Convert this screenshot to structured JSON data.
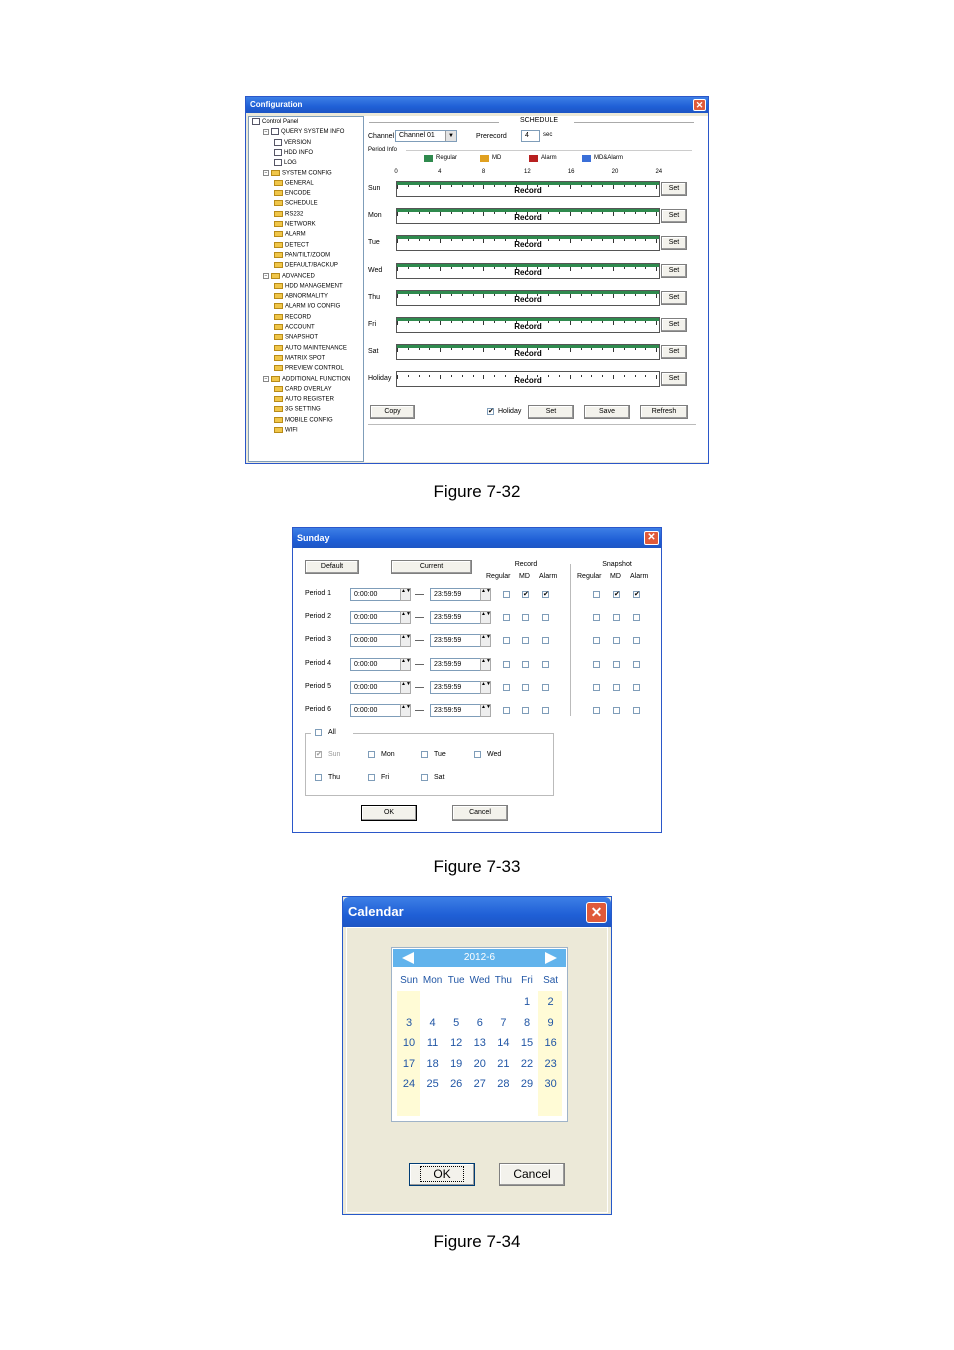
{
  "fig1": {
    "title": "Configuration",
    "tree": [
      {
        "label": "Control Panel",
        "icon": "computer-icon",
        "level": 0
      },
      {
        "label": "QUERY SYSTEM INFO",
        "icon": "doc-icon",
        "level": 1
      },
      {
        "label": "VERSION",
        "icon": "doc-icon",
        "level": 2
      },
      {
        "label": "HDD INFO",
        "icon": "doc-icon",
        "level": 2
      },
      {
        "label": "LOG",
        "icon": "doc-icon",
        "level": 2
      },
      {
        "label": "SYSTEM CONFIG",
        "icon": "folder-icon",
        "level": 1
      },
      {
        "label": "GENERAL",
        "icon": "folder-icon",
        "level": 2
      },
      {
        "label": "ENCODE",
        "icon": "folder-icon",
        "level": 2
      },
      {
        "label": "SCHEDULE",
        "icon": "folder-icon",
        "level": 2
      },
      {
        "label": "RS232",
        "icon": "folder-icon",
        "level": 2
      },
      {
        "label": "NETWORK",
        "icon": "folder-icon",
        "level": 2
      },
      {
        "label": "ALARM",
        "icon": "folder-icon",
        "level": 2
      },
      {
        "label": "DETECT",
        "icon": "folder-icon",
        "level": 2
      },
      {
        "label": "PAN/TILT/ZOOM",
        "icon": "folder-icon",
        "level": 2
      },
      {
        "label": "DEFAULT/BACKUP",
        "icon": "folder-icon",
        "level": 2
      },
      {
        "label": "ADVANCED",
        "icon": "folder-icon",
        "level": 1
      },
      {
        "label": "HDD MANAGEMENT",
        "icon": "folder-icon",
        "level": 2
      },
      {
        "label": "ABNORMALITY",
        "icon": "folder-icon",
        "level": 2
      },
      {
        "label": "ALARM I/O CONFIG",
        "icon": "folder-icon",
        "level": 2
      },
      {
        "label": "RECORD",
        "icon": "folder-icon",
        "level": 2
      },
      {
        "label": "ACCOUNT",
        "icon": "folder-icon",
        "level": 2
      },
      {
        "label": "SNAPSHOT",
        "icon": "folder-icon",
        "level": 2
      },
      {
        "label": "AUTO MAINTENANCE",
        "icon": "folder-icon",
        "level": 2
      },
      {
        "label": "MATRIX SPOT",
        "icon": "folder-icon",
        "level": 2
      },
      {
        "label": "PREVIEW CONTROL",
        "icon": "folder-icon",
        "level": 2
      },
      {
        "label": "ADDITIONAL FUNCTION",
        "icon": "folder-icon",
        "level": 1
      },
      {
        "label": "CARD OVERLAY",
        "icon": "folder-icon",
        "level": 2
      },
      {
        "label": "AUTO REGISTER",
        "icon": "folder-icon",
        "level": 2
      },
      {
        "label": "3G SETTING",
        "icon": "folder-icon",
        "level": 2
      },
      {
        "label": "MOBILE CONFIG",
        "icon": "folder-icon",
        "level": 2
      },
      {
        "label": "WIFI",
        "icon": "folder-icon",
        "level": 2
      }
    ],
    "section_title": "SCHEDULE",
    "channel_label": "Channel",
    "channel_value": "Channel 01",
    "prerecord_label": "Prerecord",
    "prerecord_value": "4",
    "sec_label": "sec",
    "period_info_label": "Period Info",
    "legend": [
      {
        "label": "Regular",
        "color": "#2f8a4e"
      },
      {
        "label": "MD",
        "color": "#e0a020"
      },
      {
        "label": "Alarm",
        "color": "#b82020"
      },
      {
        "label": "MD&Alarm",
        "color": "#3a6fd8"
      }
    ],
    "hours": [
      "0",
      "4",
      "8",
      "12",
      "16",
      "20",
      "24"
    ],
    "days": [
      {
        "name": "Sun",
        "bar": "Record",
        "set": "Set",
        "regular": true
      },
      {
        "name": "Mon",
        "bar": "Record",
        "set": "Set",
        "regular": true
      },
      {
        "name": "Tue",
        "bar": "Record",
        "set": "Set",
        "regular": true
      },
      {
        "name": "Wed",
        "bar": "Record",
        "set": "Set",
        "regular": true
      },
      {
        "name": "Thu",
        "bar": "Record",
        "set": "Set",
        "regular": true
      },
      {
        "name": "Fri",
        "bar": "Record",
        "set": "Set",
        "regular": true
      },
      {
        "name": "Sat",
        "bar": "Record",
        "set": "Set",
        "regular": true
      },
      {
        "name": "Holiday",
        "bar": "Record",
        "set": "Set",
        "regular": false
      }
    ],
    "copy_btn": "Copy",
    "holiday_label": "Holiday",
    "holiday_checked": true,
    "set_btn": "Set",
    "save_btn": "Save",
    "refresh_btn": "Refresh"
  },
  "caption1": "Figure 7-32",
  "fig2": {
    "title": "Sunday",
    "default_btn": "Default",
    "current_btn": "Current",
    "record_header": "Record",
    "snapshot_header": "Snapshot",
    "col_regular": "Regular",
    "col_md": "MD",
    "col_alarm": "Alarm",
    "periods": [
      {
        "label": "Period 1",
        "start": "0:00:00",
        "end": "23:59:59",
        "rec": [
          false,
          true,
          true
        ],
        "snap": [
          false,
          true,
          true
        ]
      },
      {
        "label": "Period 2",
        "start": "0:00:00",
        "end": "23:59:59",
        "rec": [
          false,
          false,
          false
        ],
        "snap": [
          false,
          false,
          false
        ]
      },
      {
        "label": "Period 3",
        "start": "0:00:00",
        "end": "23:59:59",
        "rec": [
          false,
          false,
          false
        ],
        "snap": [
          false,
          false,
          false
        ]
      },
      {
        "label": "Period 4",
        "start": "0:00:00",
        "end": "23:59:59",
        "rec": [
          false,
          false,
          false
        ],
        "snap": [
          false,
          false,
          false
        ]
      },
      {
        "label": "Period 5",
        "start": "0:00:00",
        "end": "23:59:59",
        "rec": [
          false,
          false,
          false
        ],
        "snap": [
          false,
          false,
          false
        ]
      },
      {
        "label": "Period 6",
        "start": "0:00:00",
        "end": "23:59:59",
        "rec": [
          false,
          false,
          false
        ],
        "snap": [
          false,
          false,
          false
        ]
      }
    ],
    "all_label": "All",
    "day_checks": [
      {
        "label": "Sun",
        "checked": true,
        "disabled": true
      },
      {
        "label": "Mon",
        "checked": false,
        "disabled": false
      },
      {
        "label": "Tue",
        "checked": false,
        "disabled": false
      },
      {
        "label": "Wed",
        "checked": false,
        "disabled": false
      },
      {
        "label": "Thu",
        "checked": false,
        "disabled": false
      },
      {
        "label": "Fri",
        "checked": false,
        "disabled": false
      },
      {
        "label": "Sat",
        "checked": false,
        "disabled": false
      }
    ],
    "ok_btn": "OK",
    "cancel_btn": "Cancel"
  },
  "caption2": "Figure 7-33",
  "fig3": {
    "title": "Calendar",
    "month": "2012-6",
    "weekdays": [
      "Sun",
      "Mon",
      "Tue",
      "Wed",
      "Thu",
      "Fri",
      "Sat"
    ],
    "weeks": [
      [
        "",
        "",
        "",
        "",
        "",
        "1",
        "2"
      ],
      [
        "3",
        "4",
        "5",
        "6",
        "7",
        "8",
        "9"
      ],
      [
        "10",
        "11",
        "12",
        "13",
        "14",
        "15",
        "16"
      ],
      [
        "17",
        "18",
        "19",
        "20",
        "21",
        "22",
        "23"
      ],
      [
        "24",
        "25",
        "26",
        "27",
        "28",
        "29",
        "30"
      ]
    ],
    "ok_btn": "OK",
    "cancel_btn": "Cancel"
  },
  "caption3": "Figure 7-34"
}
